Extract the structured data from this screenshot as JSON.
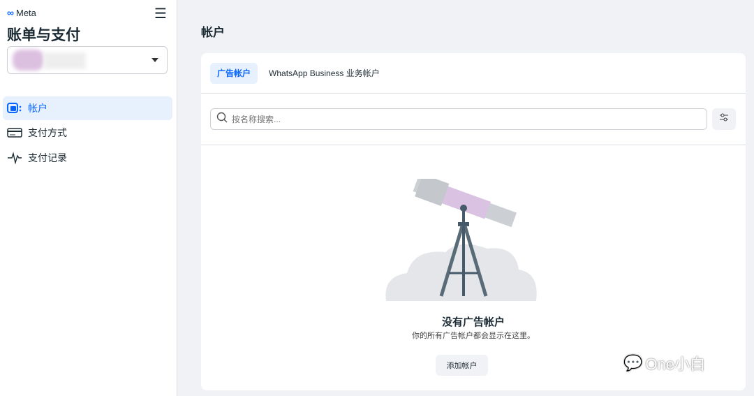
{
  "sidebar": {
    "brand": "Meta",
    "title": "账单与支付",
    "items": [
      {
        "label": "帐户"
      },
      {
        "label": "支付方式"
      },
      {
        "label": "支付记录"
      }
    ]
  },
  "main": {
    "title": "帐户",
    "tabs": [
      {
        "label": "广告帐户"
      },
      {
        "label": "WhatsApp Business 业务帐户"
      }
    ],
    "search": {
      "placeholder": "按名称搜索..."
    },
    "empty": {
      "title": "没有广告帐户",
      "subtitle": "你的所有广告帐户都会显示在这里。",
      "button": "添加帐户"
    }
  },
  "watermark": "One小白",
  "colors": {
    "accent": "#0866ff",
    "active_bg": "#e7f0fd"
  }
}
